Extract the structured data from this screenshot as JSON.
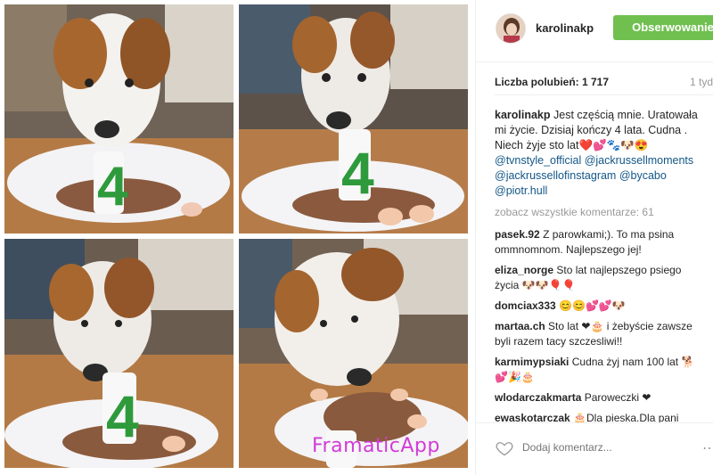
{
  "post": {
    "username": "karolinakp",
    "follow_label": "Obserwowanie",
    "likes_label": "Liczba polubień: 1 717",
    "time_label": "1 tyd",
    "watermark": "FramaticApp"
  },
  "caption": {
    "user": "karolinakp",
    "text": "Jest częścią mnie. Uratowała mi życie. Dzisiaj kończy 4 lata. Cudna . Niech żyje sto lat❤️💕🐾🐶😍",
    "tags": "@tvnstyle_official @jackrussellmoments @jackrussellofinstagram @bycabo @piotr.hull"
  },
  "more_comments": "zobacz wszystkie komentarze: 61",
  "comments": [
    {
      "user": "pasek.92",
      "text": "Z parowkami;). To ma psina ommnomnom. Najlepszego jej!"
    },
    {
      "user": "eliza_norge",
      "text": "Sto lat najlepszego psiego życia 🐶🐶🎈🎈"
    },
    {
      "user": "domciax333",
      "text": "😊😊💕💕🐶"
    },
    {
      "user": "martaa.ch",
      "text": "Sto lat ❤🎂 i żebyście zawsze byli razem tacy szczesliwi!!"
    },
    {
      "user": "karmimypsiaki",
      "text": "Cudna żyj nam 100 lat 🐕💕🎉🎂"
    },
    {
      "user": "wlodarczakmarta",
      "text": "Paroweczki ❤"
    },
    {
      "user": "ewaskotarczak",
      "text": "🎂Dla pieska.Dla pani przytulas."
    }
  ],
  "footer": {
    "add_comment_placeholder": "Dodaj komentarz...",
    "more_icon": "⋯"
  },
  "colors": {
    "follow_bg": "#70c050",
    "link": "#125688",
    "watermark": "#d23bd8"
  }
}
